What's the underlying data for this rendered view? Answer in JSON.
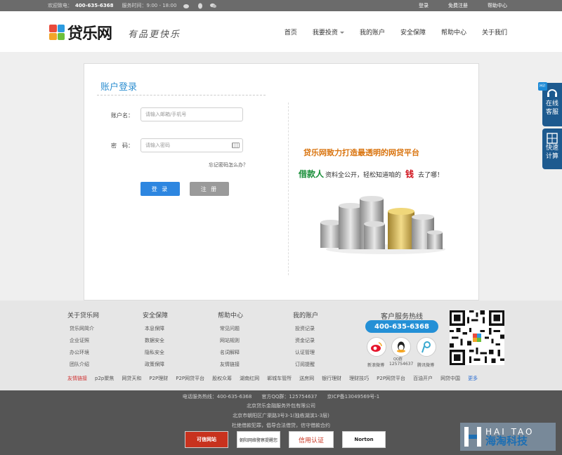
{
  "topbar": {
    "welcome": "欢迎致电：",
    "phone": "400-635-6368",
    "hours": "服务时间：9:00 - 18:00",
    "login": "登录",
    "register": "免费注册",
    "help": "帮助中心"
  },
  "header": {
    "logo_text": "贷乐网",
    "slogan": "有品更快乐",
    "nav": [
      "首页",
      "我要投资",
      "我的账户",
      "安全保障",
      "帮助中心",
      "关于我们"
    ]
  },
  "login": {
    "title": "账户登录",
    "username_label": "账户名：",
    "username_placeholder": "请输入邮箱/手机号",
    "password_label": "密　码：",
    "password_placeholder": "请输入密码",
    "forgot": "忘记密码怎么办？",
    "login_button": "登 录",
    "register_button": "注 册"
  },
  "promo": {
    "headline": "贷乐网致力打造最透明的网贷平台",
    "line_start": "借款人",
    "line_middle": "资料全公开，轻松知道咱的",
    "line_emph": "钱",
    "line_end": "去了哪！"
  },
  "side": {
    "service": "在线客服",
    "calc": "快速计算",
    "hi": "Hi!"
  },
  "footer": {
    "columns": [
      {
        "title": "关于贷乐网",
        "items": [
          "贷乐网简介",
          "企业证照",
          "办公环境",
          "团队介绍"
        ]
      },
      {
        "title": "安全保障",
        "items": [
          "本息保障",
          "数据安全",
          "隐私安全",
          "政策保障"
        ]
      },
      {
        "title": "帮助中心",
        "items": [
          "常见问题",
          "网站规则",
          "名词解释",
          "友情链接"
        ]
      },
      {
        "title": "我的账户",
        "items": [
          "投资记录",
          "资金记录",
          "认证管理",
          "订阅提醒"
        ]
      }
    ],
    "service_title": "客户服务热线",
    "hotline": "400-635-6368",
    "social": [
      "新浪微博",
      "125754637",
      "腾讯微博"
    ],
    "qq_label": "QQ群",
    "links_label": "友情链接",
    "links": [
      "p2p聚焦",
      "网贷天和",
      "P2P理财",
      "P2P网贷平台",
      "股权众筹",
      "湖南红网",
      "郸城车管所",
      "送房网",
      "银行理财",
      "理财技巧",
      "P2P网贷平台",
      "百油开户",
      "网贷中国"
    ],
    "more": "更多"
  },
  "bottom": {
    "line1": "电话服务热线：400-635-6368　　官方QQ群：125754637　　京ICP备13049569号-1",
    "line2": "北京贷乐金融服务外包有限公司",
    "line3": "北京市朝阳区广渠路3号3-1(独栋湖滨1-3层)",
    "line4": "杜绝借款犯罪，倡导合法借贷，信守借款合约",
    "badges": [
      "可信网站",
      "朝阳网络警察提醒您",
      "信用认证",
      "Norton"
    ]
  },
  "watermark": {
    "en": "HAI TAO",
    "cn": "海淘科技"
  }
}
